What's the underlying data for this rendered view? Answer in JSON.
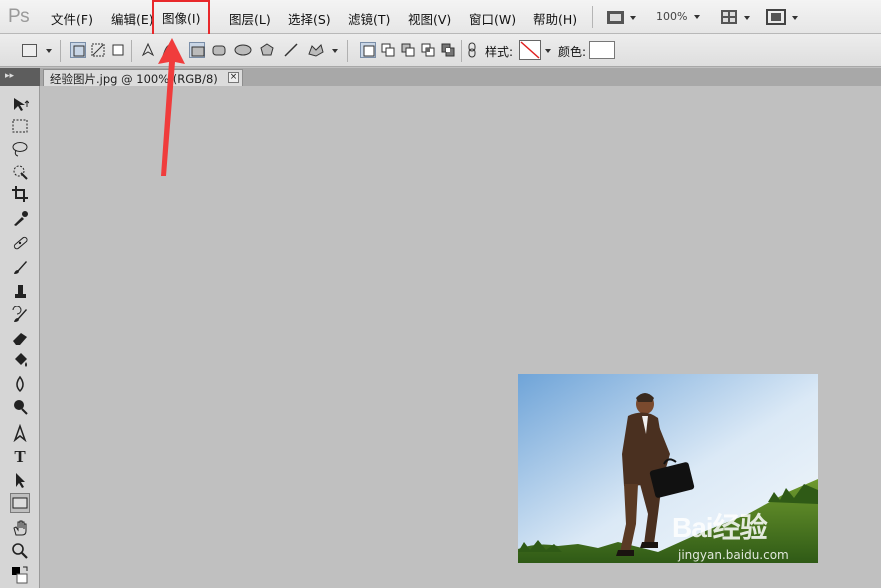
{
  "app": {
    "logo": "Ps"
  },
  "menu": {
    "items": [
      {
        "label": "文件(F)"
      },
      {
        "label": "编辑(E)"
      },
      {
        "label": "图像(I)"
      },
      {
        "label": "图层(L)"
      },
      {
        "label": "选择(S)"
      },
      {
        "label": "滤镜(T)"
      },
      {
        "label": "视图(V)"
      },
      {
        "label": "窗口(W)"
      },
      {
        "label": "帮助(H)"
      }
    ],
    "highlighted_item": "图像(I)",
    "zoom": "100%"
  },
  "options_bar": {
    "style_label": "样式:",
    "color_label": "颜色:"
  },
  "document": {
    "tab_title": "经验图片.jpg @ 100% (RGB/8)",
    "close_glyph": "×"
  },
  "toolbox": {
    "tools": [
      "move-icon",
      "marquee-icon",
      "lasso-icon",
      "quick-selection-icon",
      "crop-icon",
      "eyedropper-icon",
      "healing-brush-icon",
      "brush-icon",
      "clone-stamp-icon",
      "history-brush-icon",
      "eraser-icon",
      "paint-bucket-icon",
      "blur-icon",
      "dodge-icon",
      "pen-icon",
      "type-icon",
      "path-selection-icon",
      "rectangle-shape-icon",
      "hand-icon",
      "zoom-icon",
      "color-swatches-icon"
    ],
    "type_glyph": "T"
  },
  "watermark": {
    "main": "Bai经验",
    "sub": "jingyan.baidu.com"
  },
  "colors": {
    "highlight": "#e8282b",
    "canvas_bg": "#c0c0c0",
    "annotation_arrow": "#f03c3c"
  }
}
